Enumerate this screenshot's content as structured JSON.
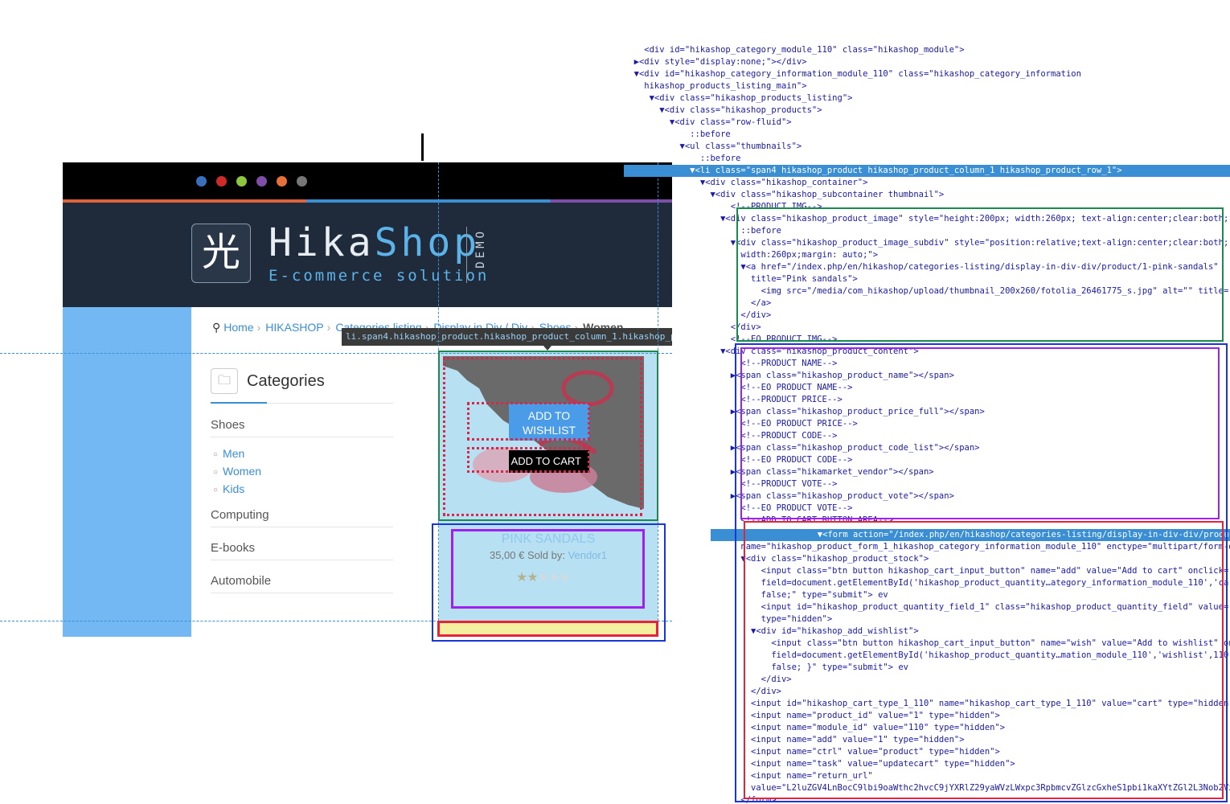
{
  "site": {
    "dots": [
      "#3a6fbd",
      "#cf2a2a",
      "#8fc63f",
      "#7e4fa8",
      "#e8703a",
      "#777777"
    ],
    "logo": {
      "glyph": "光",
      "name_part1": "Hika",
      "name_part2": "Shop",
      "tagline": "E-commerce solution",
      "demo": "DEMO"
    },
    "breadcrumb": [
      "Home",
      "HIKASHOP",
      "Categories listing",
      "Display in Div / Div",
      "Shoes",
      "Women"
    ],
    "categories": {
      "title": "Categories",
      "items": [
        "Shoes",
        "Computing",
        "E-books",
        "Automobile"
      ],
      "subitems": [
        "Men",
        "Women",
        "Kids"
      ]
    },
    "product": {
      "name": "PINK SANDALS",
      "price": "35,00 €",
      "sold_by": "Sold by:",
      "vendor": "Vendor1",
      "wishlist_label": "ADD TO WISHLIST",
      "cart_label": "ADD TO CART",
      "rating": 2,
      "rating_max": 5
    },
    "tooltip": "li.span4.hikashop_product.hikashop_product_column_1.hikashop_product_row_1"
  },
  "inspector": {
    "lines": [
      "    <div id=\"hikashop_category_module_110\" class=\"hikashop_module\">",
      "  ▶<div style=\"display:none;\"></div>",
      "  ▼<div id=\"hikashop_category_information_module_110\" class=\"hikashop_category_information",
      "    hikashop_products_listing_main\">",
      "     ▼<div class=\"hikashop_products_listing\">",
      "       ▼<div class=\"hikashop_products\">",
      "         ▼<div class=\"row-fluid\">",
      "             ::before",
      "           ▼<ul class=\"thumbnails\">",
      "               ::before",
      "             ▼<li class=\"span4 hikashop_product hikashop_product_column_1 hikashop_product_row_1\">",
      "               ▼<div class=\"hikashop_container\">",
      "                 ▼<div class=\"hikashop_subcontainer thumbnail\">",
      "                     <!--PRODUCT IMG-->",
      "                   ▼<div class=\"hikashop_product_image\" style=\"height:200px; width:260px; text-align:center;clear:both;\">",
      "                       ::before",
      "                     ▼<div class=\"hikashop_product_image_subdiv\" style=\"position:relative;text-align:center;clear:both;",
      "                       width:260px;margin: auto;\">",
      "                       ▼<a href=\"/index.php/en/hikashop/categories-listing/display-in-div-div/product/1-pink-sandals\"",
      "                         title=\"Pink sandals\">",
      "                           <img src=\"/media/com_hikashop/upload/thumbnail_200x260/fotolia_26461775_s.jpg\" alt=\"\" title=",
      "                         </a>",
      "                       </div>",
      "                     </div>",
      "                     <!--EO PRODUCT IMG-->",
      "                   ▼<div class=\"hikashop_product_content\">",
      "                       <!--PRODUCT NAME-->",
      "                     ▶<span class=\"hikashop_product_name\"></span>",
      "                       <!--EO PRODUCT NAME-->",
      "                       <!--PRODUCT PRICE-->",
      "                     ▶<span class=\"hikashop_product_price_full\"></span>",
      "                       <!--EO PRODUCT PRICE-->",
      "                       <!--PRODUCT CODE-->",
      "                     ▶<span class=\"hikashop_product_code_list\"></span>",
      "                       <!--EO PRODUCT CODE-->",
      "                     ▶<span class=\"hikamarket_vendor\"></span>",
      "                       <!--PRODUCT VOTE-->",
      "                     ▶<span class=\"hikashop_product_vote\"></span>",
      "                       <!--EO PRODUCT VOTE-->",
      "                       <!--ADD TO CART BUTTON AREA-->",
      "                     ▼<form action=\"/index.php/en/hikashop/categories-listing/display-in-div-div/product/updatecart\" me",
      "                       name=\"hikashop_product_form_1_hikashop_category_information_module_110\" enctype=\"multipart/form-d",
      "                       ▼<div class=\"hikashop_product_stock\">",
      "                           <input class=\"btn button hikashop_cart_input_button\" name=\"add\" value=\"Add to cart\" onclick=\"v",
      "                           field=document.getElementById('hikashop_product_quantity…ategory_information_module_110','cart'",
      "                           false;\" type=\"submit\"> ev",
      "                           <input id=\"hikashop_product_quantity_field_1\" class=\"hikashop_product_quantity_field\" value=\"1\"",
      "                           type=\"hidden\">",
      "                         ▼<div id=\"hikashop_add_wishlist\">",
      "                             <input class=\"btn button hikashop_cart_input_button\" name=\"wish\" value=\"Add to wishlist\" oncl",
      "                             field=document.getElementById('hikashop_product_quantity…mation_module_110','wishlist',110);",
      "                             false; }\" type=\"submit\"> ev",
      "                           </div>",
      "                         </div>",
      "                         <input id=\"hikashop_cart_type_1_110\" name=\"hikashop_cart_type_1_110\" value=\"cart\" type=\"hidden\">",
      "                         <input name=\"product_id\" value=\"1\" type=\"hidden\">",
      "                         <input name=\"module_id\" value=\"110\" type=\"hidden\">",
      "                         <input name=\"add\" value=\"1\" type=\"hidden\">",
      "                         <input name=\"ctrl\" value=\"product\" type=\"hidden\">",
      "                         <input name=\"task\" value=\"updatecart\" type=\"hidden\">",
      "                         <input name=\"return_url\"",
      "                         value=\"L2luZGV4LnBocC9lbi9oaWthc2hvcC9jYXRlZ29yaWVzLWxpc3RpbmcvZGlzcGxheS1pbi1kaXYtZGl2L3Nob2VzL2Nhd",
      "                       </form>"
    ]
  }
}
